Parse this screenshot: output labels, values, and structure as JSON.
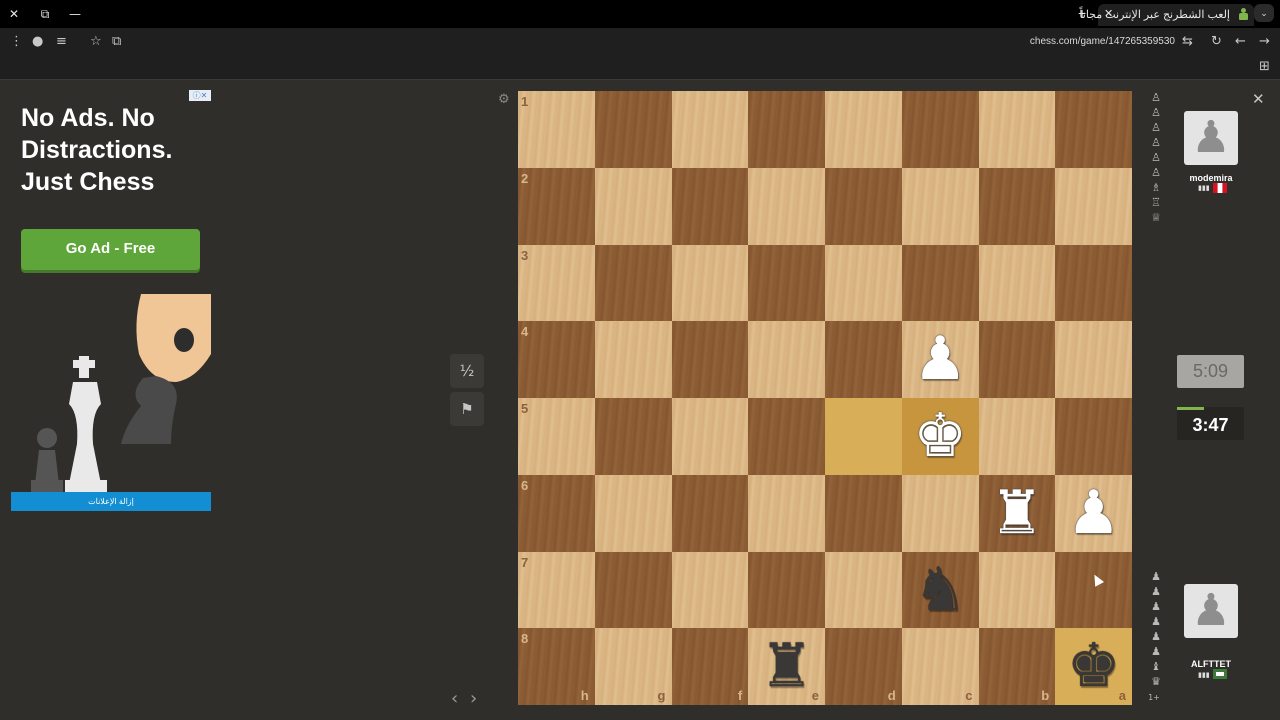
{
  "browser": {
    "tab_title": "إلعب الشطرنج عبر الإنترنت مجاناً",
    "url": "chess.com/game/147265359530",
    "icons": [
      "close-icon",
      "restore-icon",
      "minimize-icon",
      "new-tab-icon",
      "tab-menu-icon",
      "menu-icon",
      "site-info-icon",
      "customize-icon",
      "star-icon",
      "install-icon",
      "translate-icon",
      "reload-icon",
      "back-icon",
      "forward-icon",
      "extensions-icon"
    ]
  },
  "ad": {
    "corner": "ⓘ✕",
    "headline": "No Ads. No Distractions. Just Chess",
    "button": "Go Ad - Free",
    "footer": "إزالة الإعلانات"
  },
  "board": {
    "flipped": true,
    "ranks": [
      "1",
      "2",
      "3",
      "4",
      "5",
      "6",
      "7",
      "8"
    ],
    "files": [
      "h",
      "g",
      "f",
      "e",
      "d",
      "c",
      "b",
      "a"
    ],
    "highlighted": [
      "d5",
      "c5",
      "a8"
    ],
    "pieces": [
      {
        "square": "c4",
        "type": "pawn",
        "color": "white",
        "glyph": "♟"
      },
      {
        "square": "c5",
        "type": "king",
        "color": "white",
        "glyph": "♚"
      },
      {
        "square": "b6",
        "type": "rook",
        "color": "white",
        "glyph": "♜"
      },
      {
        "square": "a6",
        "type": "pawn",
        "color": "white",
        "glyph": "♟"
      },
      {
        "square": "c7",
        "type": "knight",
        "color": "black",
        "glyph": "♞"
      },
      {
        "square": "e8",
        "type": "rook",
        "color": "black",
        "glyph": "♜"
      },
      {
        "square": "a8",
        "type": "king",
        "color": "black",
        "glyph": "♚"
      }
    ],
    "light_color": "#dcb887",
    "dark_color": "#8e5e35",
    "highlight_color": "#d9ae58"
  },
  "controls": {
    "draw": "½",
    "resign_icon": "flag-icon",
    "settings_icon": "gear-icon",
    "prev": "‹",
    "next": "›"
  },
  "opponent": {
    "name": "modemira",
    "clock": "5:09",
    "captured": [
      "♙",
      "♙",
      "♙",
      "♙",
      "♙",
      "♙",
      "♗",
      "♖",
      "♕"
    ]
  },
  "player": {
    "name": "ALFTTET",
    "clock": "3:47",
    "captured": [
      "♟",
      "♟",
      "♟",
      "♟",
      "♟",
      "♟",
      "♝",
      "♛"
    ],
    "advantage": "1+"
  }
}
